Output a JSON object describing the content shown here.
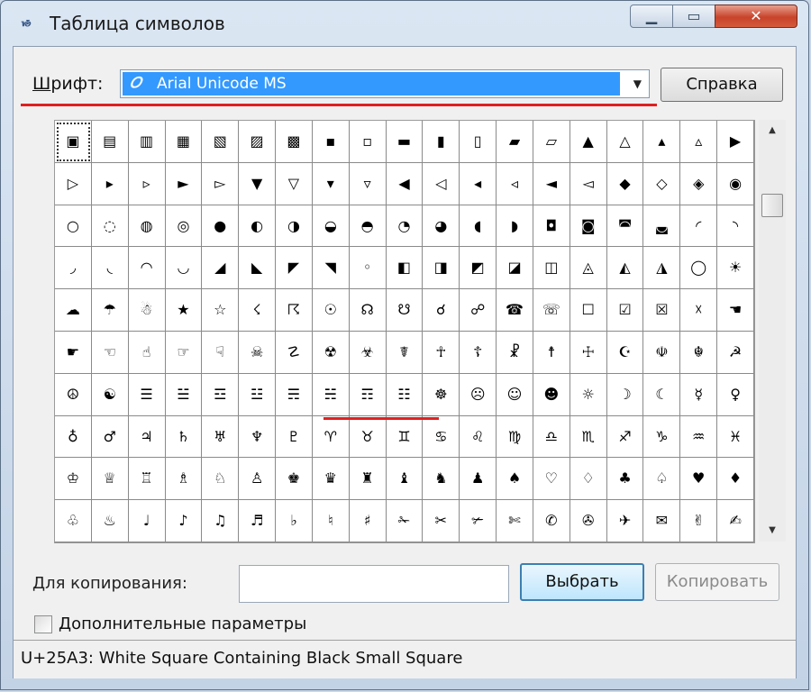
{
  "window": {
    "title": "Таблица символов",
    "app_icon_glyph": "ᏹ"
  },
  "font_row": {
    "label_underlined": "Ш",
    "label_rest": "рифт:",
    "selected_font": "Arial Unicode MS",
    "font_icon_glyph": "𝑂",
    "help_button": "Справка"
  },
  "grid": {
    "rows": [
      [
        "▣",
        "▤",
        "▥",
        "▦",
        "▧",
        "▨",
        "▩",
        "▪",
        "▫",
        "▬",
        "▮",
        "▯",
        "▰",
        "▱",
        "▲",
        "△",
        "▴",
        "▵",
        "▶"
      ],
      [
        "▷",
        "▸",
        "▹",
        "►",
        "▻",
        "▼",
        "▽",
        "▾",
        "▿",
        "◀",
        "◁",
        "◂",
        "◃",
        "◄",
        "◅",
        "◆",
        "◇",
        "◈",
        "◉"
      ],
      [
        "○",
        "◌",
        "◍",
        "◎",
        "●",
        "◐",
        "◑",
        "◒",
        "◓",
        "◔",
        "◕",
        "◖",
        "◗",
        "◘",
        "◙",
        "◚",
        "◛",
        "◜",
        "◝"
      ],
      [
        "◞",
        "◟",
        "◠",
        "◡",
        "◢",
        "◣",
        "◤",
        "◥",
        "◦",
        "◧",
        "◨",
        "◩",
        "◪",
        "◫",
        "◬",
        "◭",
        "◮",
        "◯",
        "☀"
      ],
      [
        "☁",
        "☂",
        "☃",
        "★",
        "☆",
        "☇",
        "☈",
        "☉",
        "☊",
        "☋",
        "☌",
        "☍",
        "☎",
        "☏",
        "☐",
        "☑",
        "☒",
        "☓",
        "☚"
      ],
      [
        "☛",
        "☜",
        "☝",
        "☞",
        "☟",
        "☠",
        "☡",
        "☢",
        "☣",
        "☤",
        "☥",
        "☦",
        "☧",
        "☨",
        "☩",
        "☪",
        "☫",
        "☬",
        "☭"
      ],
      [
        "☮",
        "☯",
        "☰",
        "☱",
        "☲",
        "☳",
        "☴",
        "☵",
        "☶",
        "☷",
        "☸",
        "☹",
        "☺",
        "☻",
        "☼",
        "☽",
        "☾",
        "☿",
        "♀"
      ],
      [
        "♁",
        "♂",
        "♃",
        "♄",
        "♅",
        "♆",
        "♇",
        "♈",
        "♉",
        "♊",
        "♋",
        "♌",
        "♍",
        "♎",
        "♏",
        "♐",
        "♑",
        "♒",
        "♓"
      ],
      [
        "♔",
        "♕",
        "♖",
        "♗",
        "♘",
        "♙",
        "♚",
        "♛",
        "♜",
        "♝",
        "♞",
        "♟",
        "♠",
        "♡",
        "♢",
        "♣",
        "♤",
        "♥",
        "♦"
      ],
      [
        "♧",
        "♨",
        "♩",
        "♪",
        "♫",
        "♬",
        "♭",
        "♮",
        "♯",
        "✁",
        "✂",
        "✃",
        "✄",
        "✆",
        "✇",
        "✈",
        "✉",
        "✌",
        "✍"
      ]
    ],
    "selected_index": [
      0,
      0
    ]
  },
  "bottom": {
    "copy_label": "Для копирования:",
    "copy_value": "",
    "select_button": "Выбрать",
    "copy_button": "Копировать",
    "advanced_label": "Дополнительные параметры",
    "advanced_checked": false
  },
  "status": {
    "text": "U+25A3: White Square Containing Black Small Square"
  },
  "colors": {
    "selection_blue": "#3399ff",
    "annotation_red": "#e02020"
  }
}
